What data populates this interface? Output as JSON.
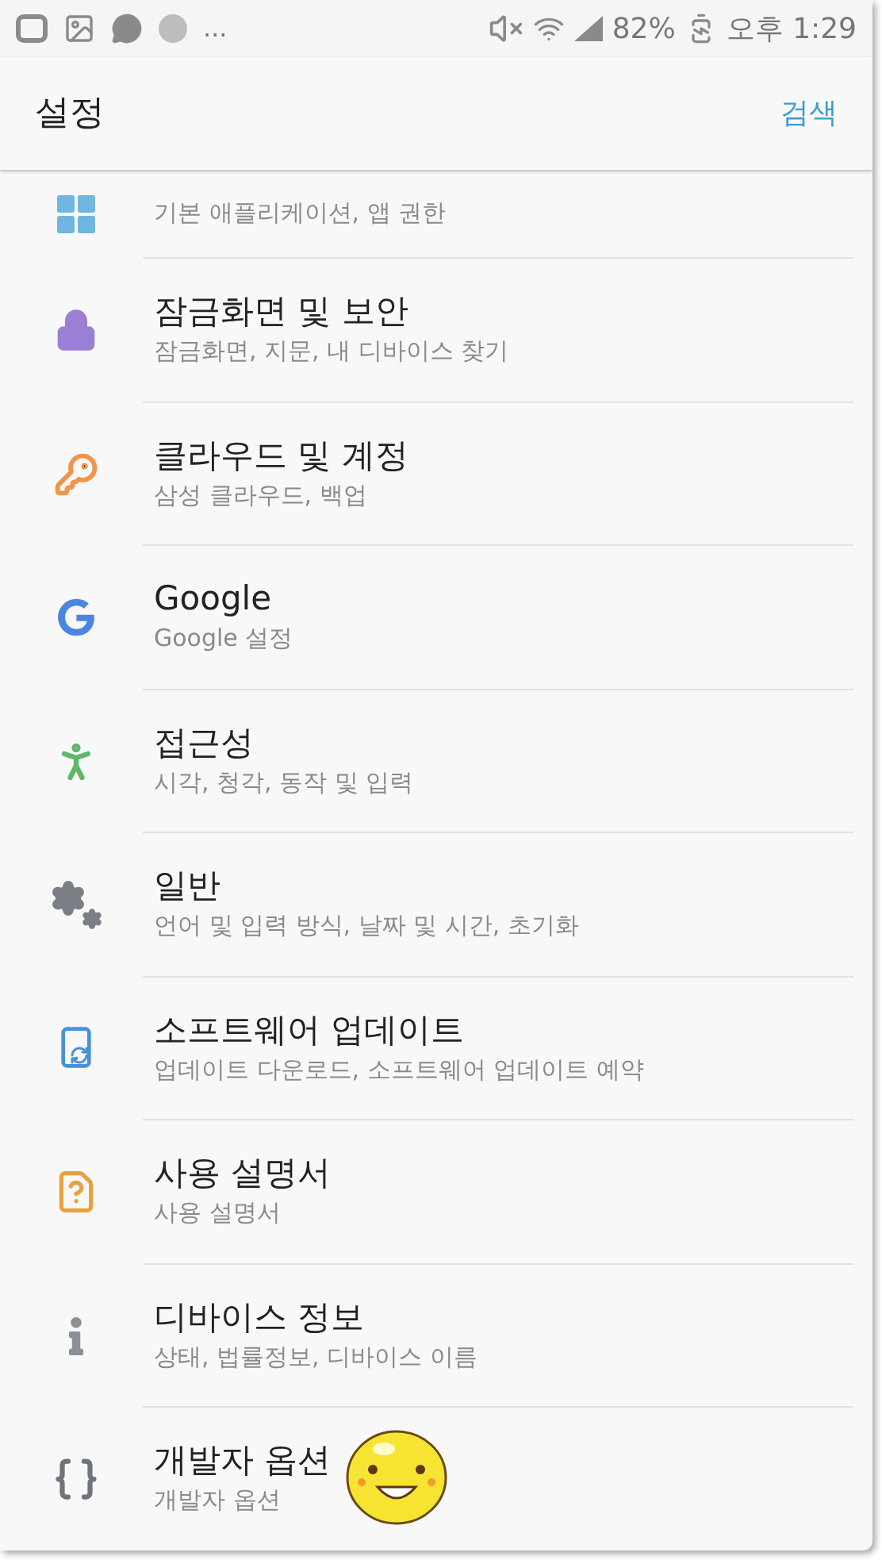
{
  "status_bar": {
    "overflow": "...",
    "battery": "82%",
    "time": "오후 1:29"
  },
  "header": {
    "title": "설정",
    "action": "검색"
  },
  "items": [
    {
      "subtitle": "기본 애플리케이션, 앱 권한"
    },
    {
      "title": "잠금화면 및 보안",
      "subtitle": "잠금화면, 지문, 내 디바이스 찾기"
    },
    {
      "title": "클라우드 및 계정",
      "subtitle": "삼성 클라우드, 백업"
    },
    {
      "title": "Google",
      "subtitle": "Google 설정"
    },
    {
      "title": "접근성",
      "subtitle": "시각, 청각, 동작 및 입력"
    },
    {
      "title": "일반",
      "subtitle": "언어 및 입력 방식, 날짜 및 시간, 초기화"
    },
    {
      "title": "소프트웨어 업데이트",
      "subtitle": "업데이트 다운로드, 소프트웨어 업데이트 예약"
    },
    {
      "title": "사용 설명서",
      "subtitle": "사용 설명서"
    },
    {
      "title": "디바이스 정보",
      "subtitle": "상태, 법률정보, 디바이스 이름"
    },
    {
      "title": "개발자 옵션",
      "subtitle": "개발자 옵션"
    }
  ]
}
